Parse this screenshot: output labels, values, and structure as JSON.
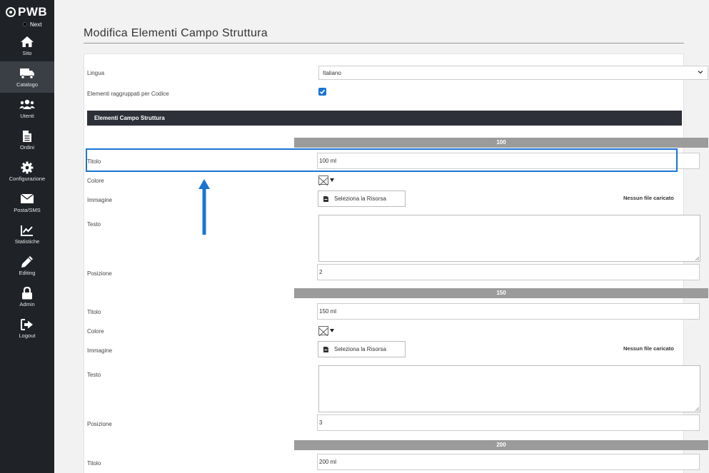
{
  "sidebar": {
    "logo": "PWB",
    "next_label": "Next",
    "items": [
      {
        "label": "Sito",
        "icon": "home-icon"
      },
      {
        "label": "Catalogo",
        "icon": "truck-icon"
      },
      {
        "label": "Utenti",
        "icon": "users-icon"
      },
      {
        "label": "Ordini",
        "icon": "document-icon"
      },
      {
        "label": "Configurazione",
        "icon": "gear-icon"
      },
      {
        "label": "Posta/SMS",
        "icon": "envelope-icon"
      },
      {
        "label": "Statistiche",
        "icon": "chart-icon"
      },
      {
        "label": "Editing",
        "icon": "pencil-icon"
      },
      {
        "label": "Admin",
        "icon": "lock-icon"
      },
      {
        "label": "Logout",
        "icon": "logout-icon"
      }
    ],
    "active_item": "Catalogo"
  },
  "page": {
    "title": "Modifica Elementi Campo Struttura",
    "lingua_label": "Lingua",
    "lingua_value": "Italiano",
    "raggruppati_label": "Elementi raggruppati per Codice",
    "raggruppati_checked": true,
    "section_title": "Elementi Campo Struttura"
  },
  "groups": [
    {
      "code": "100",
      "titolo_label": "Titolo",
      "titolo": "100 ml",
      "colore_label": "Colore",
      "immagine_label": "Immagine",
      "button_label": "Seleziona la Risorsa",
      "nofile": "Nessun file caricato",
      "testo_label": "Testo",
      "posizione_label": "Posizione",
      "posizione": "2"
    },
    {
      "code": "150",
      "titolo_label": "Titolo",
      "titolo": "150 ml",
      "colore_label": "Colore",
      "immagine_label": "Immagine",
      "button_label": "Seleziona la Risorsa",
      "nofile": "Nessun file caricato",
      "testo_label": "Testo",
      "posizione_label": "Posizione",
      "posizione": "3"
    },
    {
      "code": "200",
      "titolo_label": "Titolo",
      "titolo": "200 ml"
    }
  ],
  "colors": {
    "sidebar_bg": "#1f2227",
    "accent": "#1b74d3",
    "section_bar": "#2d3038",
    "group_bar": "#9b9b9b"
  }
}
